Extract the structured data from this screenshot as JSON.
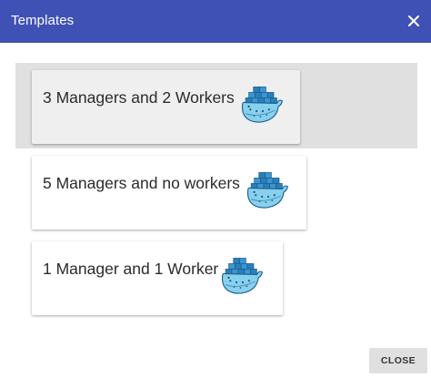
{
  "dialog": {
    "title": "Templates",
    "close_icon": "close-icon",
    "header_color": "#3f51b5",
    "close_button_label": "CLOSE"
  },
  "templates": [
    {
      "label": "3 Managers and 2 Workers",
      "icon": "docker-whale-icon",
      "selected": true
    },
    {
      "label": "5 Managers and no workers",
      "icon": "docker-whale-icon",
      "selected": false
    },
    {
      "label": "1 Manager and 1 Worker",
      "icon": "docker-whale-icon",
      "selected": false
    }
  ]
}
